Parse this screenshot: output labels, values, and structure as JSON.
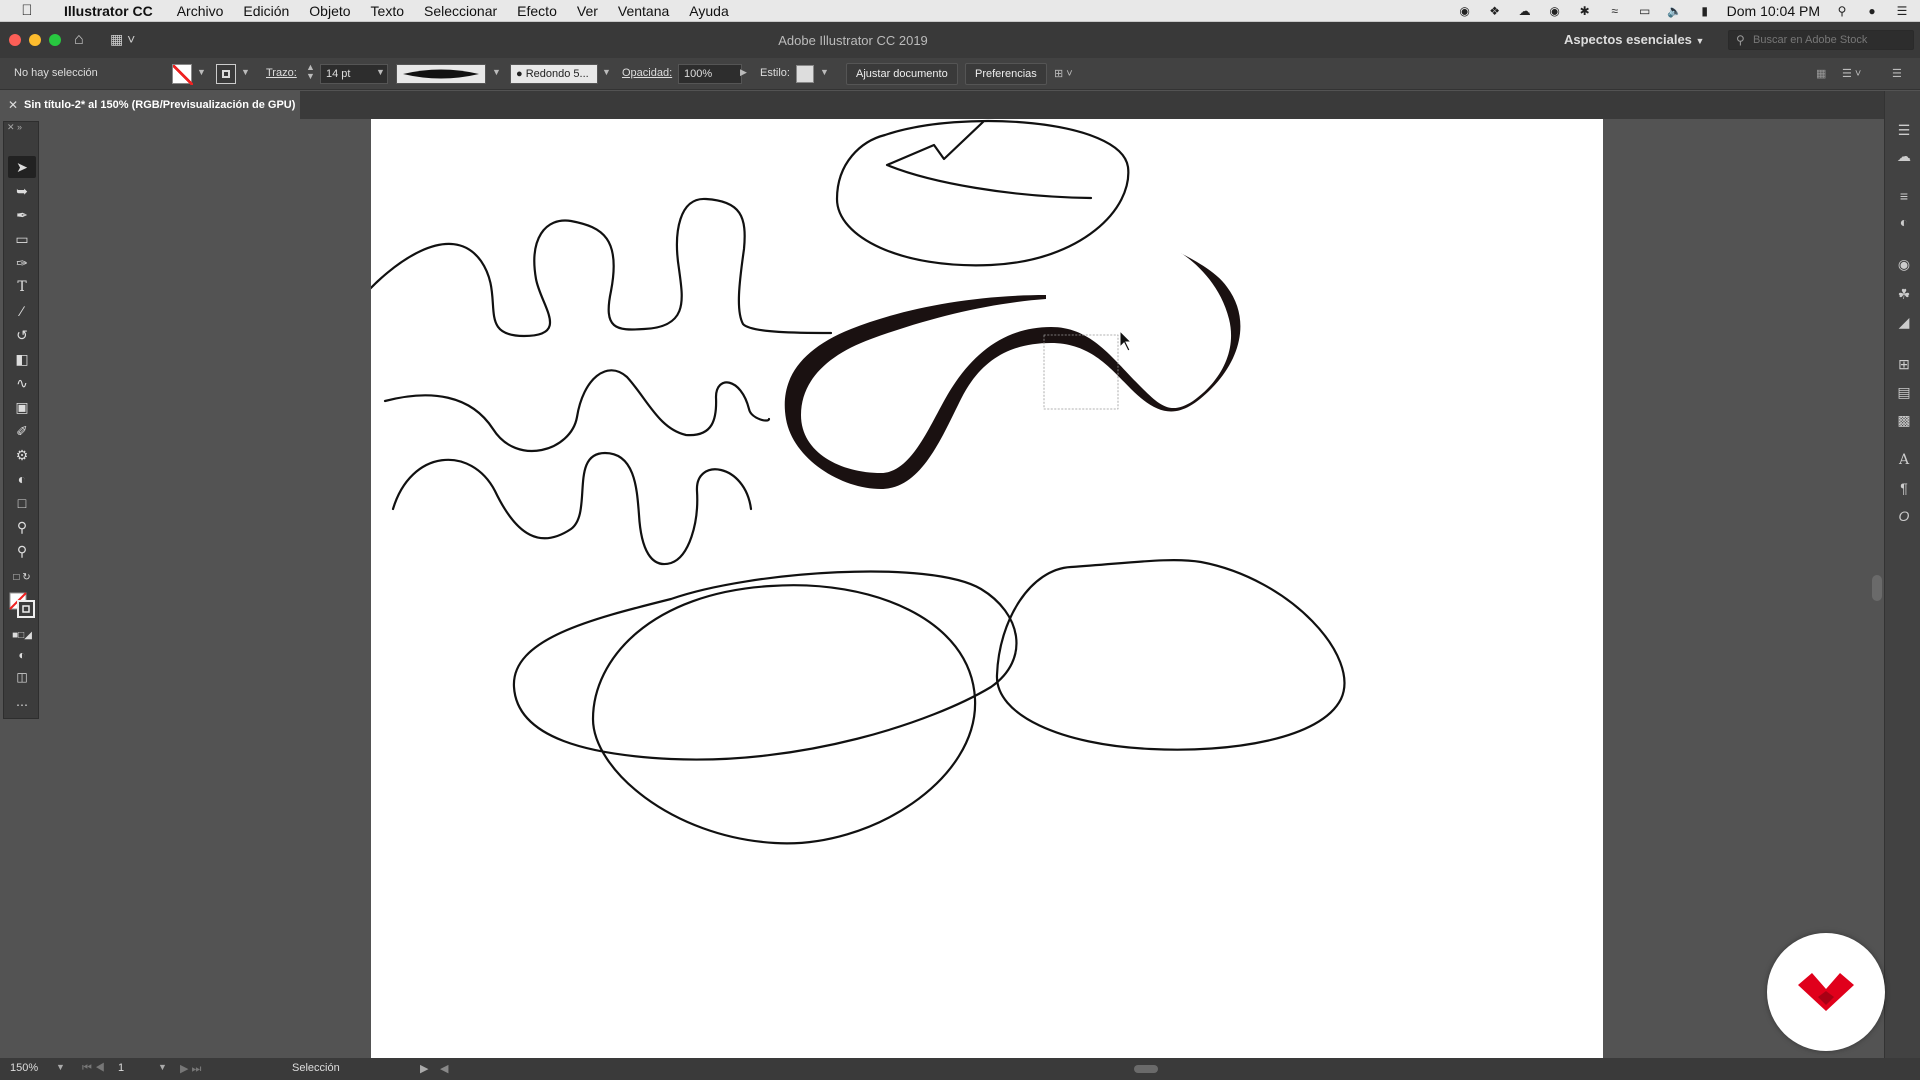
{
  "menubar": {
    "app_name": "Illustrator CC",
    "items": [
      "Archivo",
      "Edición",
      "Objeto",
      "Texto",
      "Seleccionar",
      "Efecto",
      "Ver",
      "Ventana",
      "Ayuda"
    ],
    "clock": "Dom 10:04 PM"
  },
  "appbar": {
    "title": "Adobe Illustrator CC 2019",
    "workspace": "Aspectos esenciales",
    "search_placeholder": "Buscar en Adobe Stock"
  },
  "controlbar": {
    "selection_status": "No hay selección",
    "stroke_label": "Trazo:",
    "stroke_value": "14 pt",
    "brush_label": "Redondo 5...",
    "opacity_label": "Opacidad:",
    "opacity_value": "100%",
    "style_label": "Estilo:",
    "fit_document": "Ajustar documento",
    "preferences": "Preferencias"
  },
  "document": {
    "tab_title": "Sin título-2* al 150% (RGB/Previsualización de GPU)"
  },
  "statusbar": {
    "zoom": "150%",
    "artboard_number": "1",
    "tool_status": "Selección"
  },
  "colors": {
    "menubar_bg": "#e8e8e8",
    "app_bg": "#535353",
    "panel_bg": "#424242",
    "close": "#fc5f57",
    "minimize": "#fdbc2e",
    "maximize": "#28c840",
    "brand_red": "#e0001b"
  },
  "icons": {
    "toolbar": [
      "selection-tool",
      "direct-selection-tool",
      "pen-tool",
      "rectangle-tool",
      "paintbrush-tool",
      "type-tool",
      "line-tool",
      "rotate-tool",
      "eraser-tool",
      "width-tool",
      "gradient-tool",
      "eyedropper-tool",
      "shape-builder-tool",
      "blend-tool",
      "artboard-tool",
      "pin-tool",
      "zoom-tool"
    ]
  }
}
